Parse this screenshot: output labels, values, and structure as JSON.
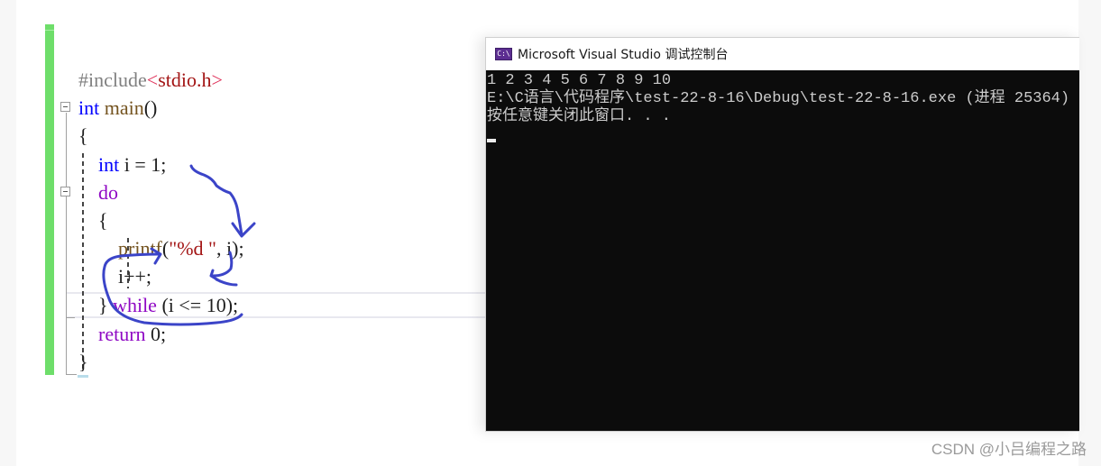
{
  "editor": {
    "lines": [
      {
        "parts": [
          {
            "t": "#include",
            "c": "inc"
          },
          {
            "t": "<",
            "c": "lt"
          },
          {
            "t": "stdio.h",
            "c": "str"
          },
          {
            "t": ">",
            "c": "lt"
          }
        ]
      },
      {
        "parts": [
          {
            "t": "int",
            "c": "kw"
          },
          {
            "t": " ",
            "c": ""
          },
          {
            "t": "main",
            "c": "fn"
          },
          {
            "t": "()",
            "c": ""
          }
        ]
      },
      {
        "parts": [
          {
            "t": "{",
            "c": ""
          }
        ]
      },
      {
        "parts": [
          {
            "t": "    ",
            "c": ""
          },
          {
            "t": "int",
            "c": "kw"
          },
          {
            "t": " i = 1;",
            "c": ""
          }
        ]
      },
      {
        "parts": [
          {
            "t": "    ",
            "c": ""
          },
          {
            "t": "do",
            "c": "kw2"
          }
        ]
      },
      {
        "parts": [
          {
            "t": "    {",
            "c": ""
          }
        ]
      },
      {
        "parts": [
          {
            "t": "        ",
            "c": ""
          },
          {
            "t": "printf",
            "c": "fn"
          },
          {
            "t": "(",
            "c": ""
          },
          {
            "t": "\"%d \"",
            "c": "str"
          },
          {
            "t": ", i);",
            "c": ""
          }
        ]
      },
      {
        "parts": [
          {
            "t": "        i++;",
            "c": ""
          }
        ]
      },
      {
        "parts": [
          {
            "t": "    } ",
            "c": ""
          },
          {
            "t": "while",
            "c": "kw2"
          },
          {
            "t": " (i <= 10);",
            "c": ""
          }
        ]
      },
      {
        "parts": [
          {
            "t": "    ",
            "c": ""
          },
          {
            "t": "return",
            "c": "kw2"
          },
          {
            "t": " 0;",
            "c": ""
          }
        ]
      },
      {
        "parts": [
          {
            "t": "}",
            "c": ""
          }
        ]
      }
    ]
  },
  "console": {
    "icon_label": "C:\\",
    "title": "Microsoft Visual Studio 调试控制台",
    "output": [
      "1 2 3 4 5 6 7 8 9 10",
      "E:\\C语言\\代码程序\\test-22-8-16\\Debug\\test-22-8-16.exe (进程 25364)",
      "按任意键关闭此窗口. . ."
    ]
  },
  "colors": {
    "change_bar": "#6ede6a",
    "annotation": "#3b44c8",
    "console_bg": "#0c0c0c"
  },
  "watermark": "CSDN @小吕编程之路"
}
